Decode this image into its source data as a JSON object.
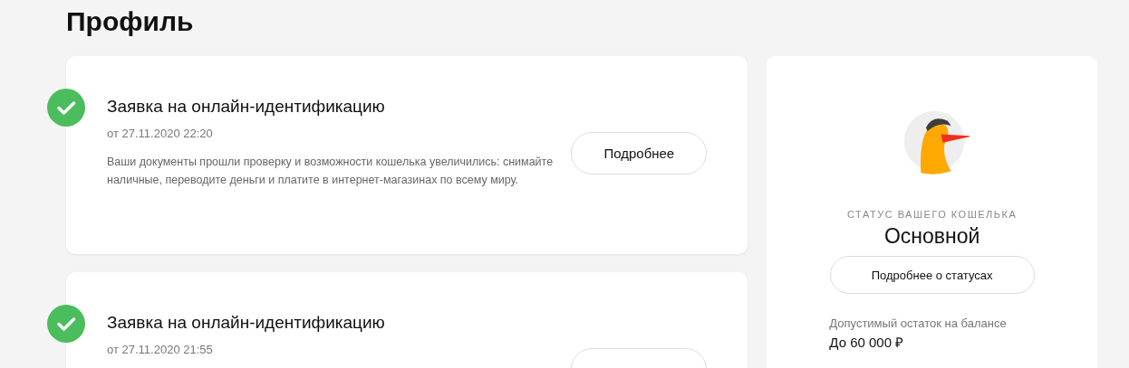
{
  "page_title": "Профиль",
  "requests": [
    {
      "done": true,
      "title": "Заявка на онлайн-идентификацию",
      "date": "от 27.11.2020 22:20",
      "description": "Ваши документы прошли проверку и возможности кошелька увеличились: снимайте наличные, переводите деньги и платите в интернет-магазинах по всему миру.",
      "button": "Подробнее"
    },
    {
      "done": true,
      "title": "Заявка на онлайн-идентификацию",
      "date": "от 27.11.2020 21:55"
    }
  ],
  "wallet": {
    "status_label": "СТАТУС ВАШЕГО КОШЕЛЬКА",
    "status": "Основной",
    "button": "Подробнее о статусах",
    "limit_label": "Допустимый остаток на балансе",
    "limit_value": "До 60 000 ₽"
  }
}
